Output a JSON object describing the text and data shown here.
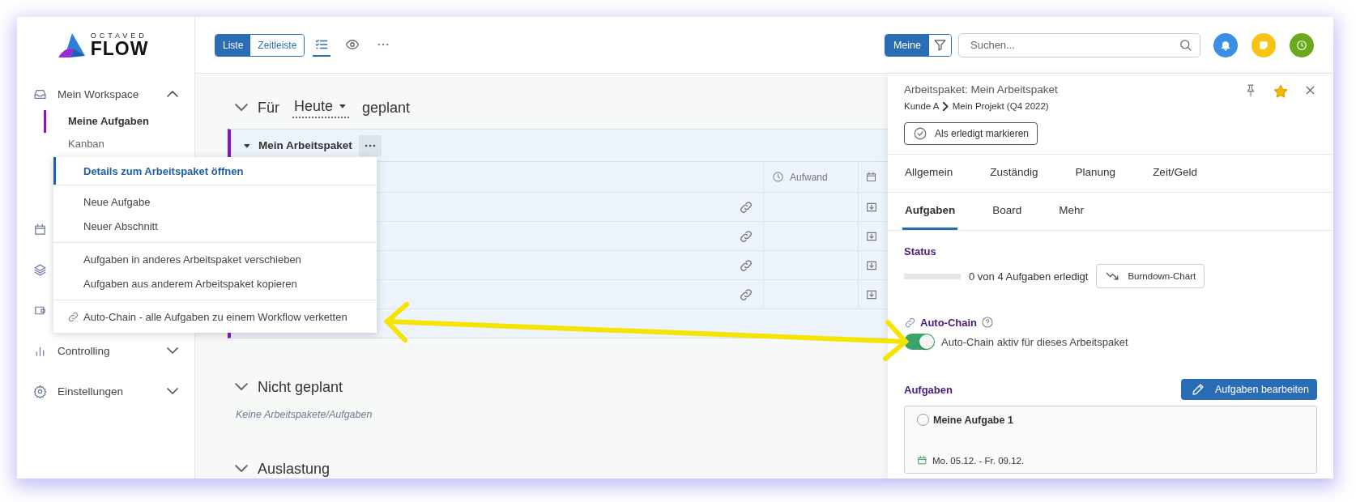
{
  "logo": {
    "overline": "OCTAVED",
    "name": "FLOW"
  },
  "sidebar": {
    "items": [
      {
        "label": "Mein Workspace",
        "kind": "inbox",
        "expanded": true,
        "children": [
          {
            "label": "Meine Aufgaben",
            "selected": true
          },
          {
            "label": "Kanban",
            "selected": false
          }
        ]
      },
      {
        "kind": "calendar"
      },
      {
        "kind": "layers"
      },
      {
        "kind": "wallet"
      },
      {
        "label": "Controlling",
        "kind": "chart",
        "expanded": false
      },
      {
        "label": "Einstellungen",
        "kind": "gear",
        "expanded": false
      }
    ]
  },
  "toolbar": {
    "view_toggle": [
      {
        "label": "Liste",
        "selected": true
      },
      {
        "label": "Zeitleiste",
        "selected": false
      }
    ],
    "views": [
      {
        "kind": "list",
        "selected": true
      },
      {
        "kind": "eye",
        "selected": false
      },
      {
        "kind": "more",
        "selected": false
      }
    ],
    "filter": {
      "label": "Meine"
    },
    "search": {
      "placeholder": "Suchen..."
    },
    "actions": [
      {
        "kind": "bell",
        "color": "#3b8fe6"
      },
      {
        "kind": "note",
        "color": "#f7c413"
      },
      {
        "kind": "clock",
        "color": "#6aa91c"
      }
    ]
  },
  "main": {
    "planned": {
      "prefix": "Für",
      "period": "Heute",
      "suffix": "geplant",
      "expanded": true
    },
    "group": {
      "title": "Mein Arbeitspaket",
      "expanded": true,
      "columns": [
        {
          "kind": "clock",
          "label": "Aufwand"
        },
        {
          "kind": "calendar"
        }
      ],
      "rows": [
        {
          "kind": "task"
        },
        {
          "kind": "task"
        },
        {
          "kind": "task"
        },
        {
          "kind": "task"
        }
      ]
    },
    "sections": [
      {
        "title": "Nicht geplant",
        "expanded": true,
        "empty": "Keine Arbeitspakete/Aufgaben"
      },
      {
        "title": "Auslastung",
        "expanded": true
      }
    ]
  },
  "context_menu": {
    "groups": [
      {
        "items": [
          {
            "label": "Details zum Arbeitspaket öffnen",
            "selected": true
          }
        ]
      },
      {
        "items": [
          {
            "label": "Neue Aufgabe",
            "selected": false
          },
          {
            "label": "Neuer Abschnitt",
            "selected": false
          }
        ]
      },
      {
        "items": [
          {
            "label": "Aufgaben in anderes Arbeitspaket verschieben",
            "selected": false
          },
          {
            "label": "Aufgaben aus anderem Arbeitspaket kopieren",
            "selected": false
          }
        ]
      },
      {
        "items": [
          {
            "label": "Auto-Chain - alle Aufgaben zu einem Workflow verketten",
            "selected": false,
            "kind": "link"
          }
        ]
      }
    ]
  },
  "panel": {
    "title": "Arbeitspaket: Mein Arbeitspaket",
    "breadcrumb": [
      "Kunde A",
      "Mein Projekt (Q4 2022)"
    ],
    "pinned": false,
    "favorite": true,
    "done_button": "Als erledigt markieren",
    "tabs": [
      {
        "label": "Allgemein",
        "selected": false
      },
      {
        "label": "Zuständig",
        "selected": false
      },
      {
        "label": "Planung",
        "selected": false
      },
      {
        "label": "Zeit/Geld",
        "selected": false
      }
    ],
    "subtabs": [
      {
        "label": "Aufgaben",
        "selected": true
      },
      {
        "label": "Board",
        "selected": false
      },
      {
        "label": "Mehr",
        "selected": false
      }
    ],
    "status": {
      "heading": "Status",
      "level": 0,
      "summary": "0 von 4 Aufgaben erledigt",
      "chart_button": "Burndown-Chart"
    },
    "auto_chain": {
      "heading": "Auto-Chain",
      "on": true,
      "label": "Auto-Chain aktiv für dieses Arbeitspaket"
    },
    "tasks": {
      "heading": "Aufgaben",
      "edit_button": "Aufgaben bearbeiten",
      "items": [
        {
          "title": "Meine Aufgabe 1",
          "done": false,
          "dates": "Mo. 05.12. - Fr. 09.12."
        }
      ]
    }
  }
}
